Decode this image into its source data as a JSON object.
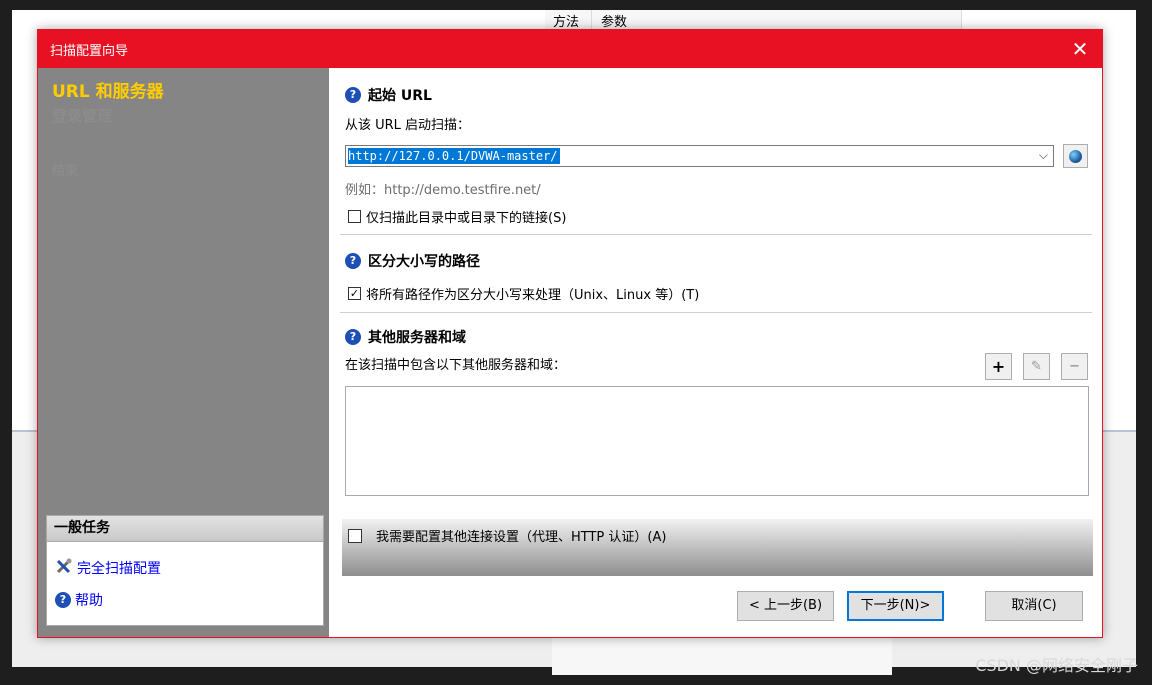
{
  "background": {
    "table_headers": [
      "方法",
      "参数"
    ],
    "watermark": "CSDN @网络安全刚子"
  },
  "dialog": {
    "title": "扫描配置向导",
    "close_glyph": "✕",
    "steps": [
      "URL 和服务器",
      "登录管理",
      "结束"
    ],
    "tasks": {
      "header": "一般任务",
      "items": [
        "完全扫描配置",
        "帮助"
      ]
    },
    "start_url": {
      "section_title": "起始 URL",
      "prompt": "从该 URL 启动扫描：",
      "url_value": "http://127.0.0.1/DVWA-master/",
      "example": "例如：http://demo.testfire.net/",
      "only_dir_checkbox": "仅扫描此目录中或目录下的链接(S)",
      "only_dir_checked": false
    },
    "case_sensitive": {
      "section_title": "区分大小写的路径",
      "checkbox": "将所有路径作为区分大小写来处理（Unix、Linux 等）(T)",
      "checked": true
    },
    "other_servers": {
      "section_title": "其他服务器和域",
      "prompt": "在该扫描中包含以下其他服务器和域：",
      "add_glyph": "+",
      "edit_glyph": "✎",
      "remove_glyph": "−"
    },
    "connection": {
      "checkbox": "我需要配置其他连接设置（代理、HTTP 认证）(A)",
      "checked": false
    },
    "buttons": {
      "prev": "< 上一步(B)",
      "next": "下一步(N)>",
      "cancel": "取消(C)"
    },
    "help_glyph": "?",
    "checkmark": "✓",
    "chevron": "⌵",
    "colors": {
      "title_bar": "#e81123",
      "active_step": "#ffcc00",
      "link": "#0000ff",
      "selection": "#0078d7"
    }
  }
}
